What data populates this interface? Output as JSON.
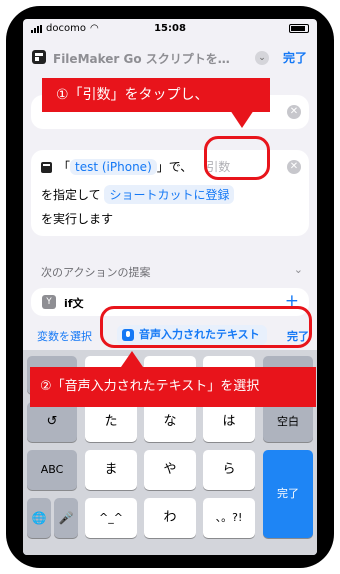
{
  "status_bar": {
    "carrier": "docomo",
    "time": "15:08"
  },
  "nav": {
    "title": "FileMaker Go スクリプトを…",
    "done": "完了"
  },
  "annotation_1": {
    "text": "①「引数」をタップし、"
  },
  "annotation_2": {
    "text": "②「音声入力されたテキスト」を選択"
  },
  "action": {
    "open_bracket": "「",
    "file_chip": "test (iPhone)",
    "close_bracket": "」で、",
    "param_placeholder": "引数",
    "line2_prefix": "を指定して",
    "shortcut_chip": "ショートカットに登録",
    "line3": "を実行します"
  },
  "suggestions": {
    "title": "次のアクションの提案",
    "items": [
      {
        "icon": "Y",
        "label": "if文"
      }
    ]
  },
  "variable_bar": {
    "select_label": "変数を選択",
    "chip_label": "音声入力されたテキスト",
    "done": "完了"
  },
  "keyboard": {
    "rows": [
      [
        "→",
        "あ",
        "か",
        "さ",
        "⌫"
      ],
      [
        "↺",
        "た",
        "な",
        "は",
        "空白"
      ],
      [
        "ABC",
        "ま",
        "や",
        "ら",
        "完了"
      ],
      [
        "🌐",
        "🎤",
        "^_^",
        "わ",
        "、。?!"
      ]
    ]
  }
}
